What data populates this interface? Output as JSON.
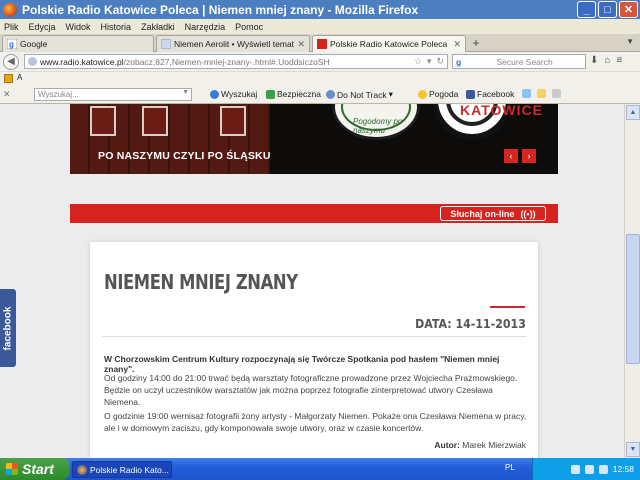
{
  "window": {
    "title": "Polskie Radio Katowice Poleca | Niemen mniej znany - Mozilla Firefox",
    "controls": {
      "minimize": "_",
      "maximize": "□",
      "close": "✕"
    }
  },
  "menu": [
    "Plik",
    "Edycja",
    "Widok",
    "Historia",
    "Zakładki",
    "Narzędzia",
    "Pomoc"
  ],
  "tabs": [
    {
      "label": "Google",
      "active": false
    },
    {
      "label": "Niemen Aerolit • Wyświetl temat - ...",
      "active": false
    },
    {
      "label": "Polskie Radio Katowice Poleca | Ni...",
      "active": true
    }
  ],
  "newtab_label": "+",
  "url": {
    "host": "www.radio.katowice.pl",
    "path": "/zobacz,827,Niemen-mniej-znany-.html#.UoddsiczoSH"
  },
  "searchbox": {
    "engine": "g",
    "placeholder": "Secure Search"
  },
  "bookmarks": [
    {
      "label": "A"
    }
  ],
  "toolbar": {
    "close": "✕",
    "search_placeholder": "Wyszukaj...",
    "items": [
      {
        "label": "Wyszukaj",
        "icon": "search-icon"
      },
      {
        "label": "Bezpieczna",
        "icon": "shield-icon"
      },
      {
        "label": "Do Not Track",
        "icon": "eye-icon"
      },
      {
        "label": "Pogoda",
        "icon": "weather-icon"
      },
      {
        "label": "Facebook",
        "icon": "facebook-icon"
      }
    ]
  },
  "banner": {
    "caption": "PO NASZYMU CZYLI PO ŚLĄSKU",
    "logo_text": "KATOWICE",
    "logo_arc": "Pogodomy po naszymu",
    "prev": "‹",
    "next": "›"
  },
  "listen_label": "Słuchaj on-line",
  "facebook_tab": "facebook",
  "article": {
    "title": "NIEMEN MNIEJ ZNANY",
    "date": "DATA: 14-11-2013",
    "lead": "W Chorzowskim Centrum Kultury rozpoczynają się Twórcze Spotkania pod hasłem \"Niemen mniej znany\".",
    "p1": "Od godziny 14:00 do 21:00 trwać będą warsztaty fotograficzne prowadzone przez Wojciecha Prażmowskiego. Będzie on uczył uczestników warsztatów jak można poprzez fotografie zinterpretować utwory Czesława Niemena.",
    "p2": "O godzinie 19:00 wernisaż fotografii żony artysty - Małgorzaty Niemen. Pokaże ona Czesława Niemena w pracy, ale i w domowym zaciszu, gdy komponowała swoje utwory, oraz w czasie koncertów.",
    "author_label": "Autor:",
    "author": "Marek Mierzwiak"
  },
  "taskbar": {
    "start": "Start",
    "task": "Polskie Radio Kato...",
    "lang": "PL",
    "clock": "12:58"
  }
}
